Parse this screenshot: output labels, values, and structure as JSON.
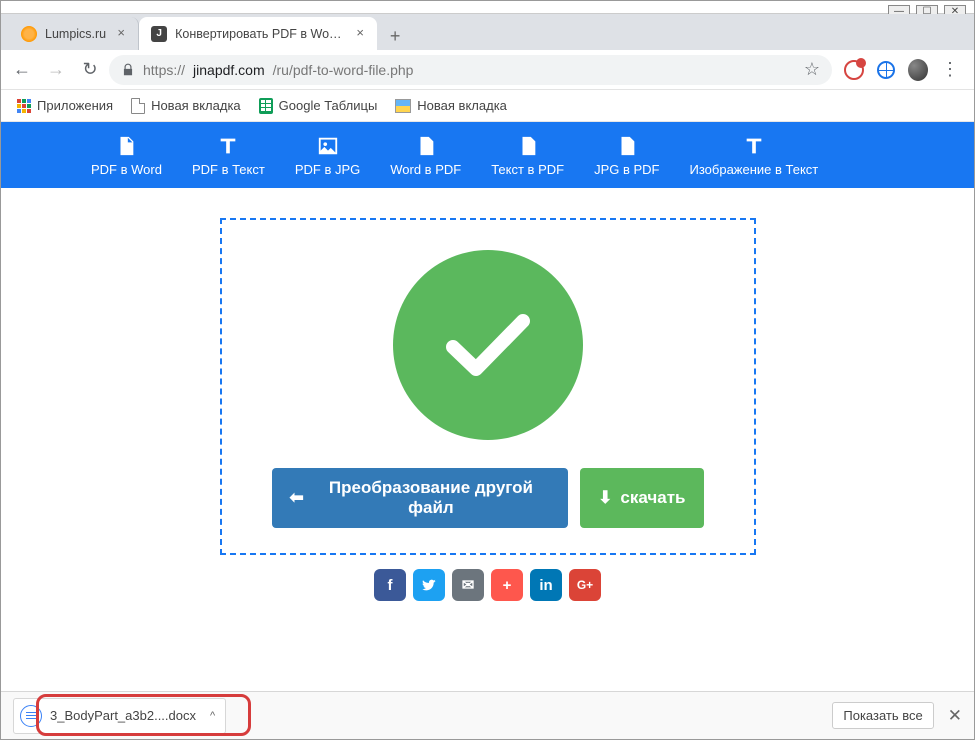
{
  "window": {
    "min": "—",
    "max": "☐",
    "close": "✕"
  },
  "tabs": {
    "items": [
      {
        "title": "Lumpics.ru"
      },
      {
        "title": "Конвертировать PDF в Word - F"
      }
    ],
    "add": "+"
  },
  "addr": {
    "back": "←",
    "fwd": "→",
    "reload": "↻",
    "scheme": "https://",
    "host": "jinapdf.com",
    "path": "/ru/pdf-to-word-file.php",
    "star": "☆",
    "menu": "⋮"
  },
  "bookmarks": {
    "apps": "Приложения",
    "items": [
      {
        "label": "Новая вкладка",
        "icon": "doc"
      },
      {
        "label": "Google Таблицы",
        "icon": "sheets"
      },
      {
        "label": "Новая вкладка",
        "icon": "pic"
      }
    ]
  },
  "toolbar": {
    "items": [
      "PDF в Word",
      "PDF в Текст",
      "PDF в JPG",
      "Word в PDF",
      "Текст в PDF",
      "JPG в PDF",
      "Изображение в Текст"
    ]
  },
  "buttons": {
    "convert": "Преобразование другой файл",
    "download": "скачать"
  },
  "social_colors": [
    "#3b5998",
    "#1da1f2",
    "#6c757d",
    "#fe574d",
    "#0077b5",
    "#db4437"
  ],
  "social_glyphs": [
    "f",
    "",
    "✉",
    "+",
    "in",
    "G+"
  ],
  "dlbar": {
    "file": "3_BodyPart_a3b2....docx",
    "chev": "^",
    "showall": "Показать все",
    "close": "✕"
  }
}
